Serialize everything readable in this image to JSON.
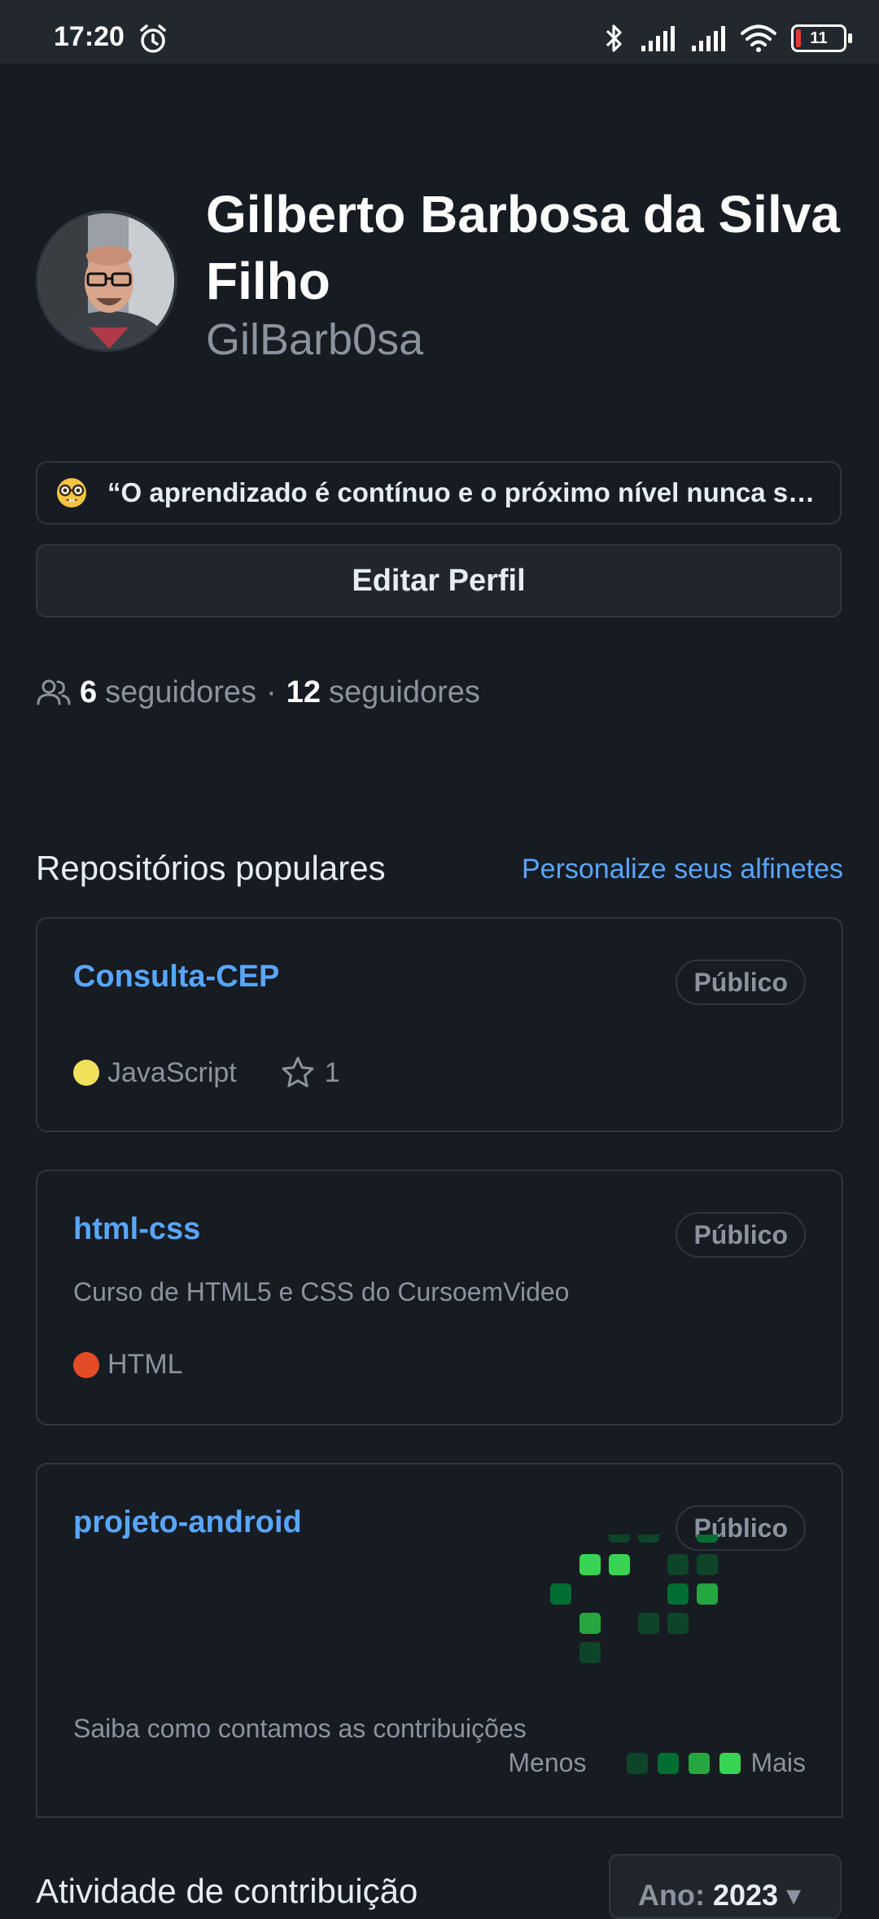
{
  "status_bar": {
    "time": "17:20",
    "battery": "11"
  },
  "profile": {
    "name": "Gilberto Barbosa da Silva Filho",
    "username": "GilBarb0sa",
    "status_emoji": "nerd-face-emoji",
    "status_text": "“O aprendizado é contínuo e o próximo nível nunca será o último.”",
    "edit_button": "Editar Perfil",
    "followers_count": "6",
    "followers_label": "seguidores",
    "separator": "·",
    "following_count": "12",
    "following_label": "seguidores"
  },
  "popular": {
    "title": "Repositórios populares",
    "customize_link": "Personalize seus alfinetes",
    "repos": [
      {
        "name": "Consulta-CEP",
        "visibility": "Público",
        "language": "JavaScript",
        "language_color": "#f1e05a",
        "stars": "1"
      },
      {
        "name": "html-css",
        "visibility": "Público",
        "description": "Curso de HTML5 e CSS do CursoemVideo",
        "language": "HTML",
        "language_color": "#e34c26"
      },
      {
        "name": "projeto-android",
        "visibility": "Público"
      }
    ]
  },
  "contributions": {
    "note": "Saiba como contamos as contribuições",
    "less_label": "Menos",
    "more_label": "Mais",
    "level_colors": [
      "#0e4429",
      "#006d32",
      "#26a641",
      "#39d353"
    ]
  },
  "activity": {
    "title": "Atividade de contribuição",
    "year_prefix": "Ano:",
    "year": "2023"
  }
}
